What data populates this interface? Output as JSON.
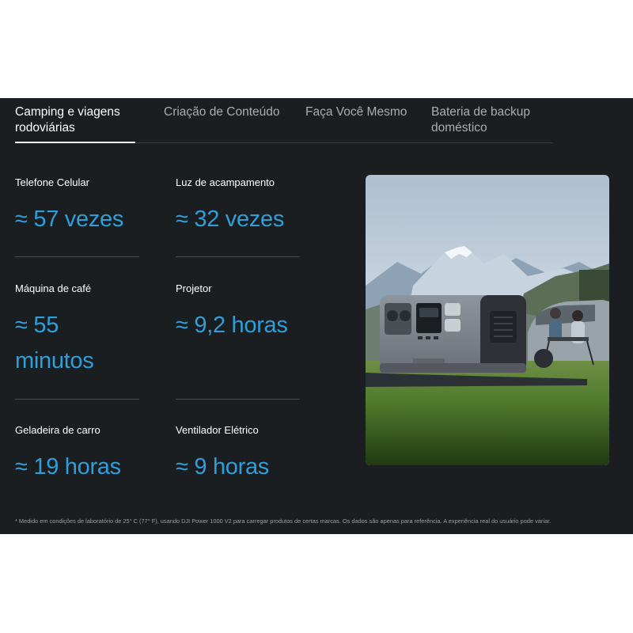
{
  "tabs": [
    {
      "label_line1": "Camping e viagens",
      "label_line2": "rodoviárias",
      "active": true
    },
    {
      "label_line1": "Criação de Conteúdo",
      "label_line2": "",
      "active": false
    },
    {
      "label_line1": "Faça Você Mesmo",
      "label_line2": "",
      "active": false
    },
    {
      "label_line1": "Bateria de backup",
      "label_line2": "doméstico",
      "active": false
    }
  ],
  "stats": [
    {
      "label": "Telefone Celular",
      "value": "≈ 57 vezes"
    },
    {
      "label": "Luz de acampamento",
      "value": "≈ 32 vezes"
    },
    {
      "label": "Máquina de café",
      "value_line1": "≈ 55",
      "value_line2": "minutos"
    },
    {
      "label": "Projetor",
      "value": "≈ 9,2 horas"
    },
    {
      "label": "Geladeira de carro",
      "value": "≈ 19 horas"
    },
    {
      "label": "Ventilador Elétrico",
      "value": "≈ 9 horas"
    }
  ],
  "footnote": "* Medido em condições de laboratório de 25° C (77° F), usando DJI Power 1000 V2 para carregar produtos de certas marcas. Os dados são apenas para referência. A experiência real do usuário pode variar.",
  "colors": {
    "background": "#1b1e21",
    "accent": "#2f9ed9",
    "tab_inactive": "#a9adb2"
  }
}
